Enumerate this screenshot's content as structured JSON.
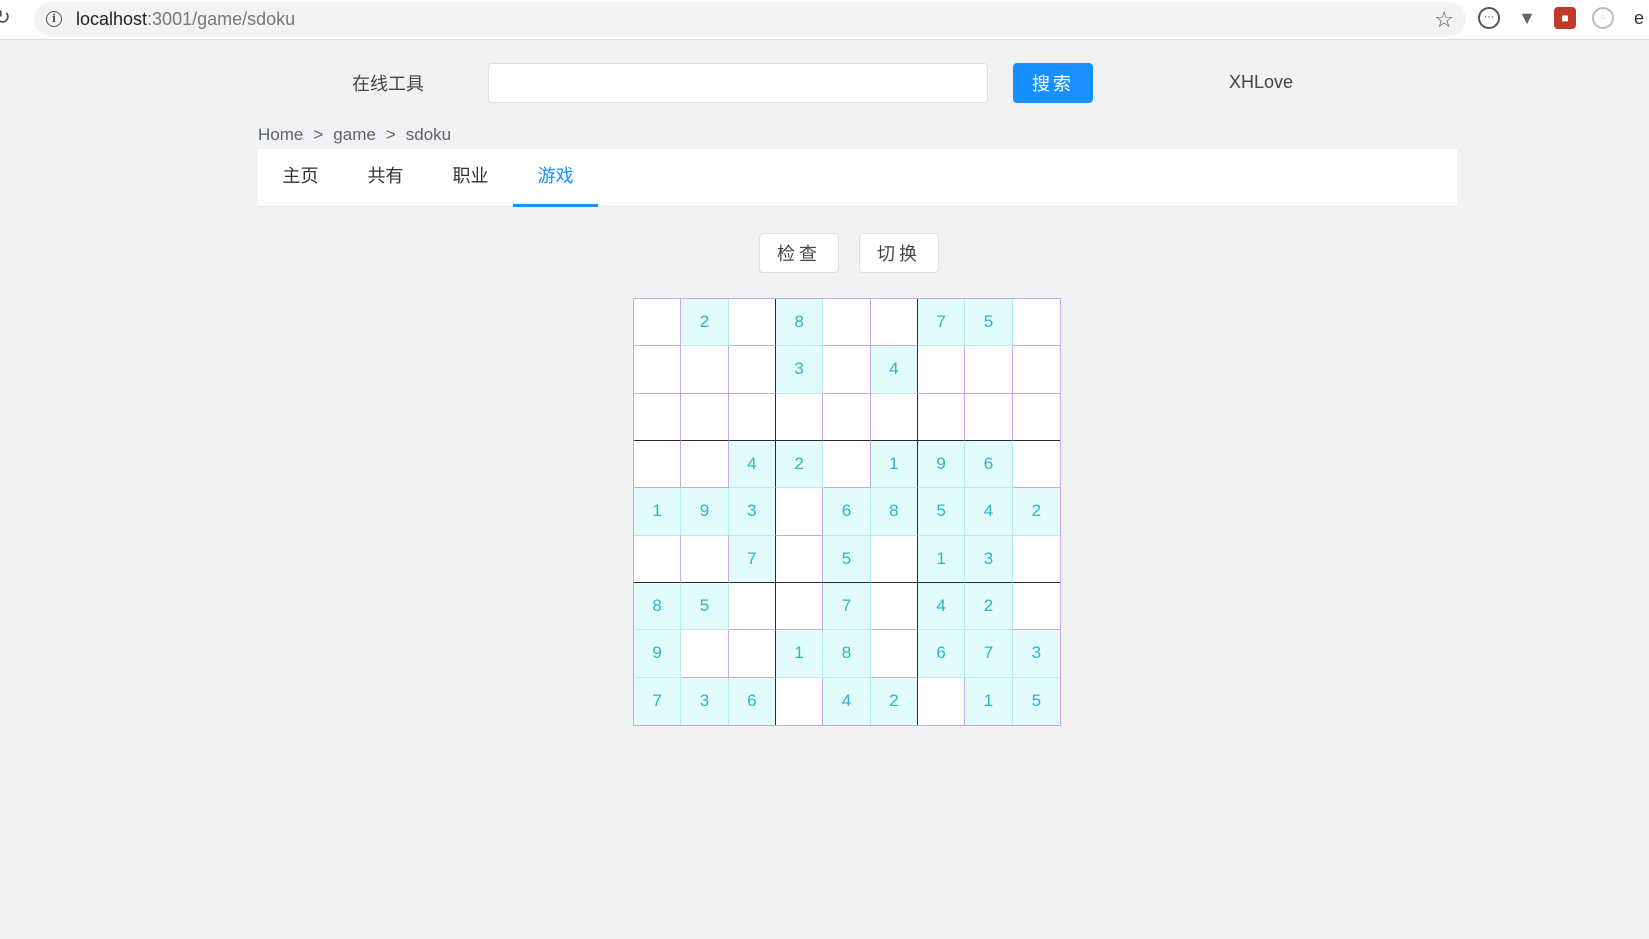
{
  "browser": {
    "url_host": "localhost",
    "url_path": ":3001/game/sdoku"
  },
  "header": {
    "site_title": "在线工具",
    "search_value": "",
    "search_button": "搜索",
    "user_name": "XHLove"
  },
  "breadcrumb": [
    "Home",
    "game",
    "sdoku"
  ],
  "tabs": [
    {
      "label": "主页",
      "active": false
    },
    {
      "label": "共有",
      "active": false
    },
    {
      "label": "职业",
      "active": false
    },
    {
      "label": "游戏",
      "active": true
    }
  ],
  "actions": {
    "check_label": "检查",
    "switch_label": "切换"
  },
  "colors": {
    "accent": "#1890ff",
    "digit": "#2ab5c8",
    "given_cell_bg": "#e2fbfb",
    "grid_line": "#c6a8ec"
  },
  "sudoku": {
    "grid": [
      [
        0,
        2,
        0,
        8,
        0,
        0,
        7,
        5,
        0
      ],
      [
        0,
        0,
        0,
        3,
        0,
        4,
        0,
        0,
        0
      ],
      [
        0,
        0,
        0,
        0,
        0,
        0,
        0,
        0,
        0
      ],
      [
        0,
        0,
        4,
        2,
        0,
        1,
        9,
        6,
        0
      ],
      [
        1,
        9,
        3,
        0,
        6,
        8,
        5,
        4,
        2
      ],
      [
        0,
        0,
        7,
        0,
        5,
        0,
        1,
        3,
        0
      ],
      [
        8,
        5,
        0,
        0,
        7,
        0,
        4,
        2,
        0
      ],
      [
        9,
        0,
        0,
        1,
        8,
        0,
        6,
        7,
        3
      ],
      [
        7,
        3,
        6,
        0,
        4,
        2,
        0,
        1,
        5
      ]
    ]
  }
}
